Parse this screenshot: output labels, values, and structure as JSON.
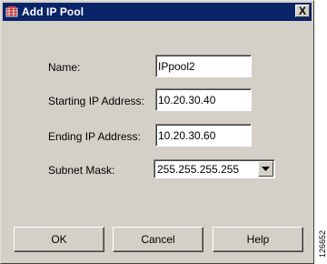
{
  "window": {
    "title": "Add IP Pool",
    "close_glyph": "X"
  },
  "form": {
    "name": {
      "label": "Name:",
      "value": "IPpool2"
    },
    "starting_ip": {
      "label": "Starting IP Address:",
      "value": "10.20.30.40"
    },
    "ending_ip": {
      "label": "Ending IP Address:",
      "value": "10.20.30.60"
    },
    "subnet_mask": {
      "label": "Subnet Mask:",
      "value": "255.255.255.255"
    }
  },
  "buttons": {
    "ok": "OK",
    "cancel": "Cancel",
    "help": "Help"
  },
  "figure_id": "126652",
  "colors": {
    "titlebar": "#0a246a",
    "face": "#d4d0c8"
  }
}
